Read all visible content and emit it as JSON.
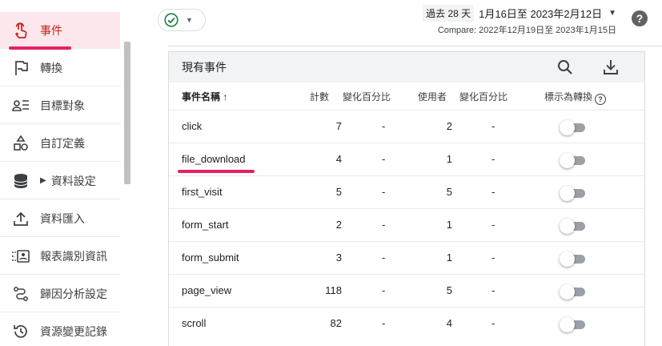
{
  "sidebar": {
    "items": [
      {
        "label": "事件",
        "icon": "touch-icon",
        "active": true
      },
      {
        "label": "轉換",
        "icon": "flag-icon"
      },
      {
        "label": "目標對象",
        "icon": "audience-icon"
      },
      {
        "label": "自訂定義",
        "icon": "shapes-icon"
      },
      {
        "label": "資料設定",
        "icon": "database-icon",
        "caret": "▶"
      },
      {
        "label": "資料匯入",
        "icon": "upload-icon"
      },
      {
        "label": "報表識別資訊",
        "icon": "id-icon"
      },
      {
        "label": "歸因分析設定",
        "icon": "attribution-icon"
      },
      {
        "label": "資源變更記錄",
        "icon": "history-icon"
      }
    ]
  },
  "header": {
    "status_caret": "▼",
    "date_chip": "過去 28 天",
    "date_range": "1月16日至 2023年2月12日",
    "date_caret": "▼",
    "compare": "Compare: 2022年12月19日至 2023年1月15日",
    "help": "?"
  },
  "card": {
    "title": "現有事件",
    "columns": {
      "name": "事件名稱",
      "sort_arrow": "↑",
      "count": "計數",
      "count_change": "變化百分比",
      "users": "使用者",
      "users_change": "變化百分比",
      "mark_conversion": "標示為轉換"
    },
    "rows": [
      {
        "name": "click",
        "count": "7",
        "count_change": "-",
        "users": "2",
        "users_change": "-",
        "conversion": false
      },
      {
        "name": "file_download",
        "count": "4",
        "count_change": "-",
        "users": "1",
        "users_change": "-",
        "conversion": false
      },
      {
        "name": "first_visit",
        "count": "5",
        "count_change": "-",
        "users": "5",
        "users_change": "-",
        "conversion": false
      },
      {
        "name": "form_start",
        "count": "2",
        "count_change": "-",
        "users": "1",
        "users_change": "-",
        "conversion": false
      },
      {
        "name": "form_submit",
        "count": "3",
        "count_change": "-",
        "users": "1",
        "users_change": "-",
        "conversion": false
      },
      {
        "name": "page_view",
        "count": "118",
        "count_change": "-",
        "users": "5",
        "users_change": "-",
        "conversion": false
      },
      {
        "name": "scroll",
        "count": "82",
        "count_change": "-",
        "users": "4",
        "users_change": "-",
        "conversion": false
      }
    ]
  },
  "colors": {
    "accent": "#c5221f",
    "highlight": "#e91e63",
    "active_bg": "#fce8ec",
    "check": "#188038"
  }
}
